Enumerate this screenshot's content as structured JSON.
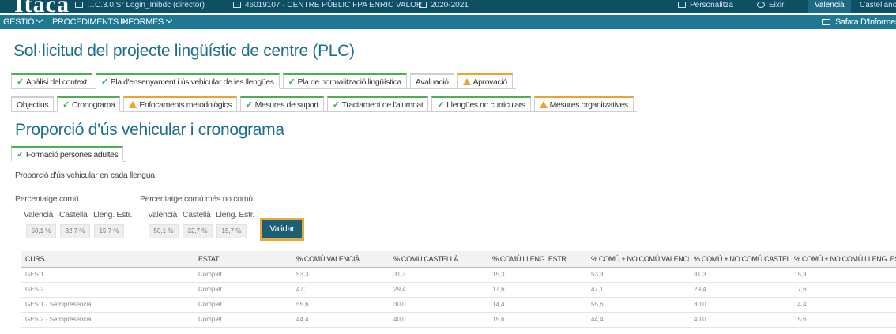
{
  "topbar": {
    "logo": "Itaca",
    "user": "…C.3.0.Sr Login_Inibdc (director)",
    "centre": "46019107 · CENTRE PÚBLIC FPA ENRIC VALOR",
    "year": "2020-2021",
    "personalize": "Personalitza",
    "exit": "Eixir",
    "lang_valencia": "Valencià",
    "lang_castella": "Castellano"
  },
  "menu": {
    "gestio": "GESTIÓ",
    "procediments": "PROCEDIMENTS",
    "informes": "INFORMES",
    "safata": "Safata D'Informes"
  },
  "page_title": "Sol·licitud del projecte lingüístic de centre (PLC)",
  "main_tabs": [
    {
      "label": "Anàlisi del context",
      "status": "done"
    },
    {
      "label": "Pla d'ensenyament i ús vehicular de les llengües",
      "status": "done"
    },
    {
      "label": "Pla de normalització lingüística",
      "status": "done"
    },
    {
      "label": "Avaluació",
      "status": "none"
    },
    {
      "label": "Aprovació",
      "status": "warn"
    }
  ],
  "sub_tabs": [
    {
      "label": "Objectius",
      "status": "none"
    },
    {
      "label": "Cronograma",
      "status": "done"
    },
    {
      "label": "Enfocaments metodològics",
      "status": "warn"
    },
    {
      "label": "Mesures de suport",
      "status": "done"
    },
    {
      "label": "Tractament de l'alumnat",
      "status": "done"
    },
    {
      "label": "Llengües no curriculars",
      "status": "done"
    },
    {
      "label": "Mesures organitzatives",
      "status": "warn"
    }
  ],
  "section_title": "Proporció d'ús vehicular i cronograma",
  "inner_tab": {
    "label": "Formació persones adultes",
    "status": "done"
  },
  "subtitle": "Proporció d'ús vehicular en cada llengua",
  "common": {
    "label": "Percentatge comú",
    "cols": [
      "Valencià",
      "Castellà",
      "Lleng. Estr."
    ],
    "values": [
      "50,1 %",
      "32,7 %",
      "15,7 %"
    ]
  },
  "common_plus": {
    "label": "Percentatge comú més no comú",
    "cols": [
      "Valencià",
      "Castellà",
      "Lleng. Estr."
    ],
    "values": [
      "50,1 %",
      "32,7 %",
      "15,7 %"
    ]
  },
  "validate_label": "Validar",
  "table": {
    "headers": [
      "CURS",
      "ESTAT",
      "% COMÚ VALENCIÀ",
      "% COMÚ CASTELLÀ",
      "% COMÚ LLENG. ESTR.",
      "% COMÚ + NO COMÚ VALENCIÀ",
      "% COMÚ + NO COMÚ CASTELLÀ",
      "% COMÚ + NO COMÚ LLENG. ESTR."
    ],
    "rows": [
      [
        "GES 1",
        "Complet",
        "53,3",
        "31,3",
        "15,3",
        "53,3",
        "31,3",
        "15,3"
      ],
      [
        "GES 2",
        "Complet",
        "47,1",
        "29,4",
        "17,6",
        "47,1",
        "29,4",
        "17,6"
      ],
      [
        "GES 1 - Semipresencial",
        "Complet",
        "55,6",
        "30,0",
        "14,4",
        "55,6",
        "30,0",
        "14,4"
      ],
      [
        "GES 2 - Semipresencial",
        "Complet",
        "44,4",
        "40,0",
        "15,6",
        "44,4",
        "40,0",
        "15,6"
      ]
    ]
  }
}
